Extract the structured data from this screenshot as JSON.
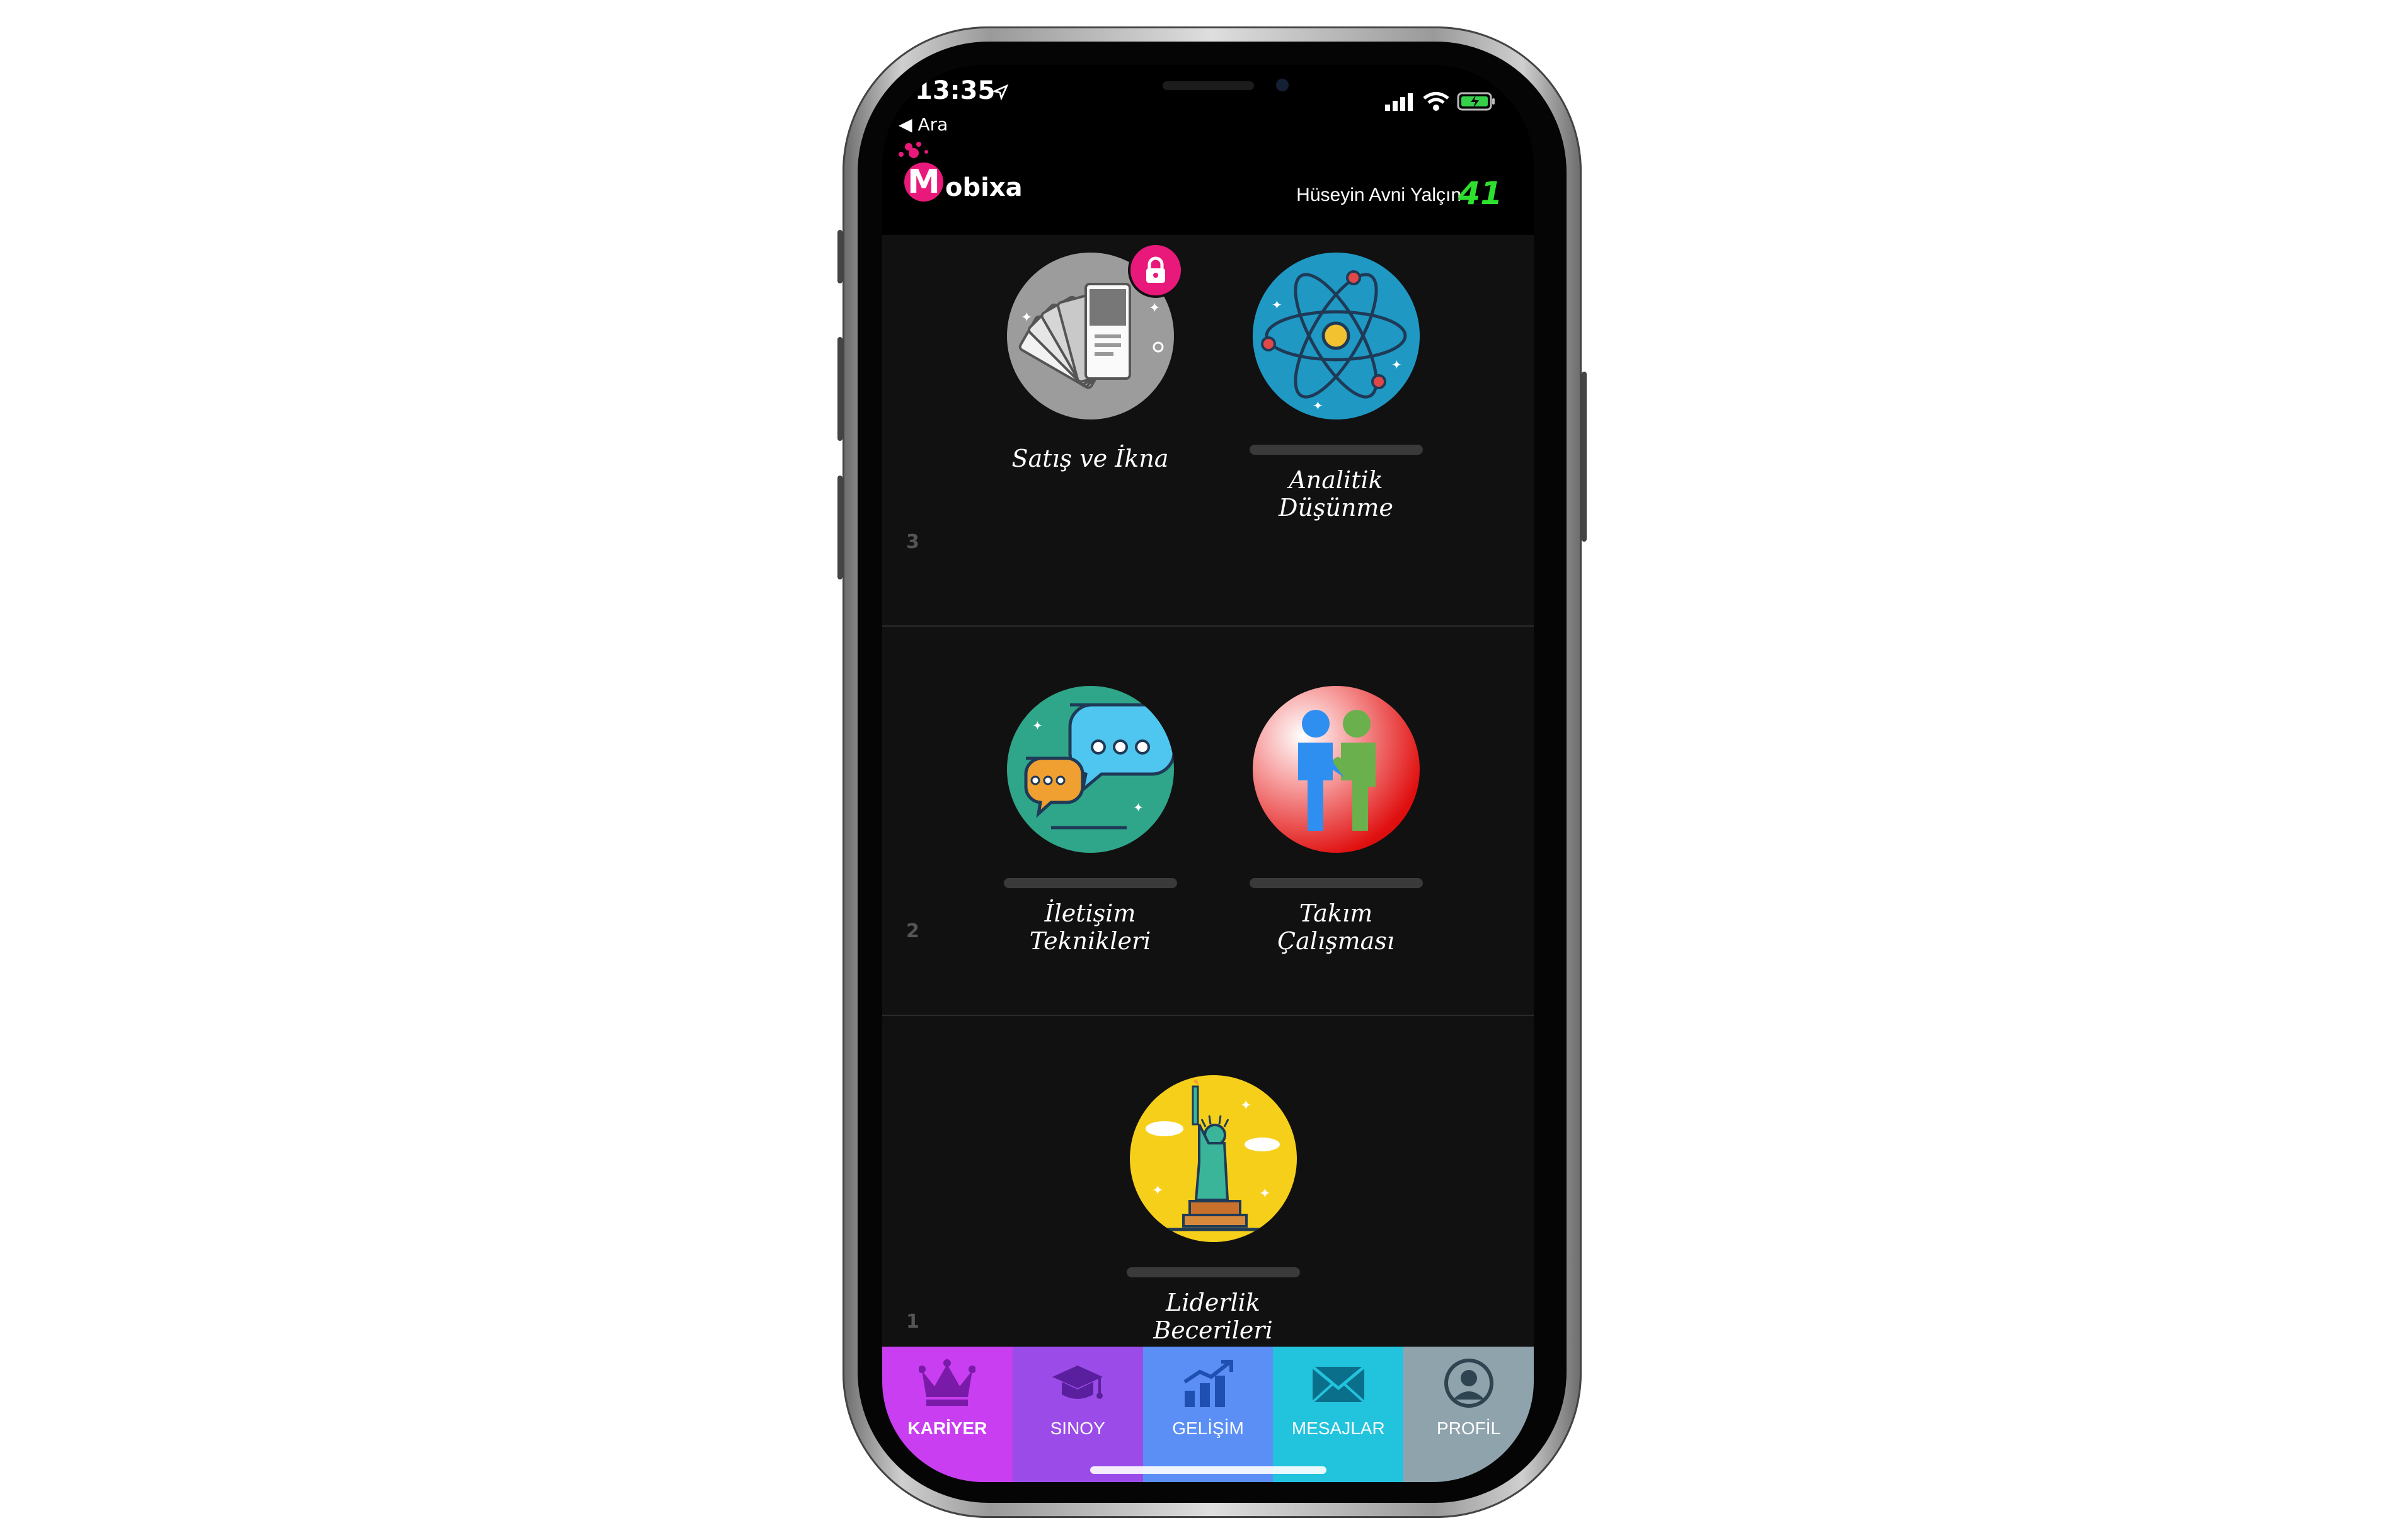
{
  "statusbar": {
    "time": "13:35",
    "back_label": "Ara"
  },
  "header": {
    "logo_letter": "M",
    "logo_text": "obixa",
    "user_name": "Hüseyin Avni Yalçın",
    "score": "41"
  },
  "sections": [
    {
      "level": "3",
      "skills": [
        {
          "label": "Satış ve İkna",
          "locked": true
        },
        {
          "label": "Analitik Düşünme",
          "locked": false
        }
      ]
    },
    {
      "level": "2",
      "skills": [
        {
          "label": "İletişim Teknikleri",
          "locked": false
        },
        {
          "label": "Takım Çalışması",
          "locked": false
        }
      ]
    },
    {
      "level": "1",
      "skills": [
        {
          "label": "Liderlik Becerileri",
          "locked": false
        }
      ]
    }
  ],
  "tabs": [
    {
      "label": "KARİYER",
      "icon": "crown-icon",
      "color": "#c93ef0",
      "active": true
    },
    {
      "label": "SINOY",
      "icon": "graduation-cap-icon",
      "color": "#9b4ce8",
      "active": false
    },
    {
      "label": "GELİŞİM",
      "icon": "growth-chart-icon",
      "color": "#5b8ff5",
      "active": false
    },
    {
      "label": "MESAJLAR",
      "icon": "envelope-icon",
      "color": "#22c3dd",
      "active": false
    },
    {
      "label": "PROFİL",
      "icon": "profile-icon",
      "color": "#8fa3ad",
      "active": false
    }
  ]
}
